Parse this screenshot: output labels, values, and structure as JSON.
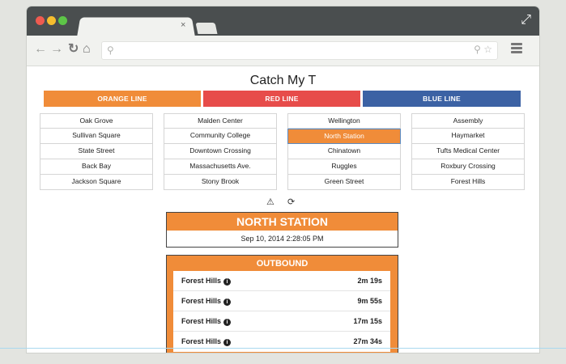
{
  "browser": {
    "tab_close_glyph": "×"
  },
  "app": {
    "title": "Catch My T"
  },
  "lines": [
    {
      "label": "ORANGE LINE",
      "color": "#f08c39"
    },
    {
      "label": "RED LINE",
      "color": "#e74c4a"
    },
    {
      "label": "BLUE LINE",
      "color": "#3c62a4"
    }
  ],
  "stations": {
    "col0": [
      "Oak Grove",
      "Sullivan Square",
      "State Street",
      "Back Bay",
      "Jackson Square"
    ],
    "col1": [
      "Malden Center",
      "Community College",
      "Downtown Crossing",
      "Massachusetts Ave.",
      "Stony Brook"
    ],
    "col2": [
      "Wellington",
      "North Station",
      "Chinatown",
      "Ruggles",
      "Green Street"
    ],
    "col3": [
      "Assembly",
      "Haymarket",
      "Tufts Medical Center",
      "Roxbury Crossing",
      "Forest Hills"
    ],
    "selected": "North Station"
  },
  "icons": {
    "alert": "warning-icon",
    "refresh": "refresh-icon"
  },
  "station_panel": {
    "name": "NORTH STATION",
    "time": "Sep 10, 2014 2:28:05 PM"
  },
  "outbound": {
    "title": "OUTBOUND",
    "trips": [
      {
        "destination": "Forest Hills",
        "eta": "2m 19s"
      },
      {
        "destination": "Forest Hills",
        "eta": "9m 55s"
      },
      {
        "destination": "Forest Hills",
        "eta": "17m 15s"
      },
      {
        "destination": "Forest Hills",
        "eta": "27m 34s"
      }
    ]
  },
  "colors": {
    "accent_orange": "#f08c39",
    "selected_border": "#5b8bc4"
  }
}
